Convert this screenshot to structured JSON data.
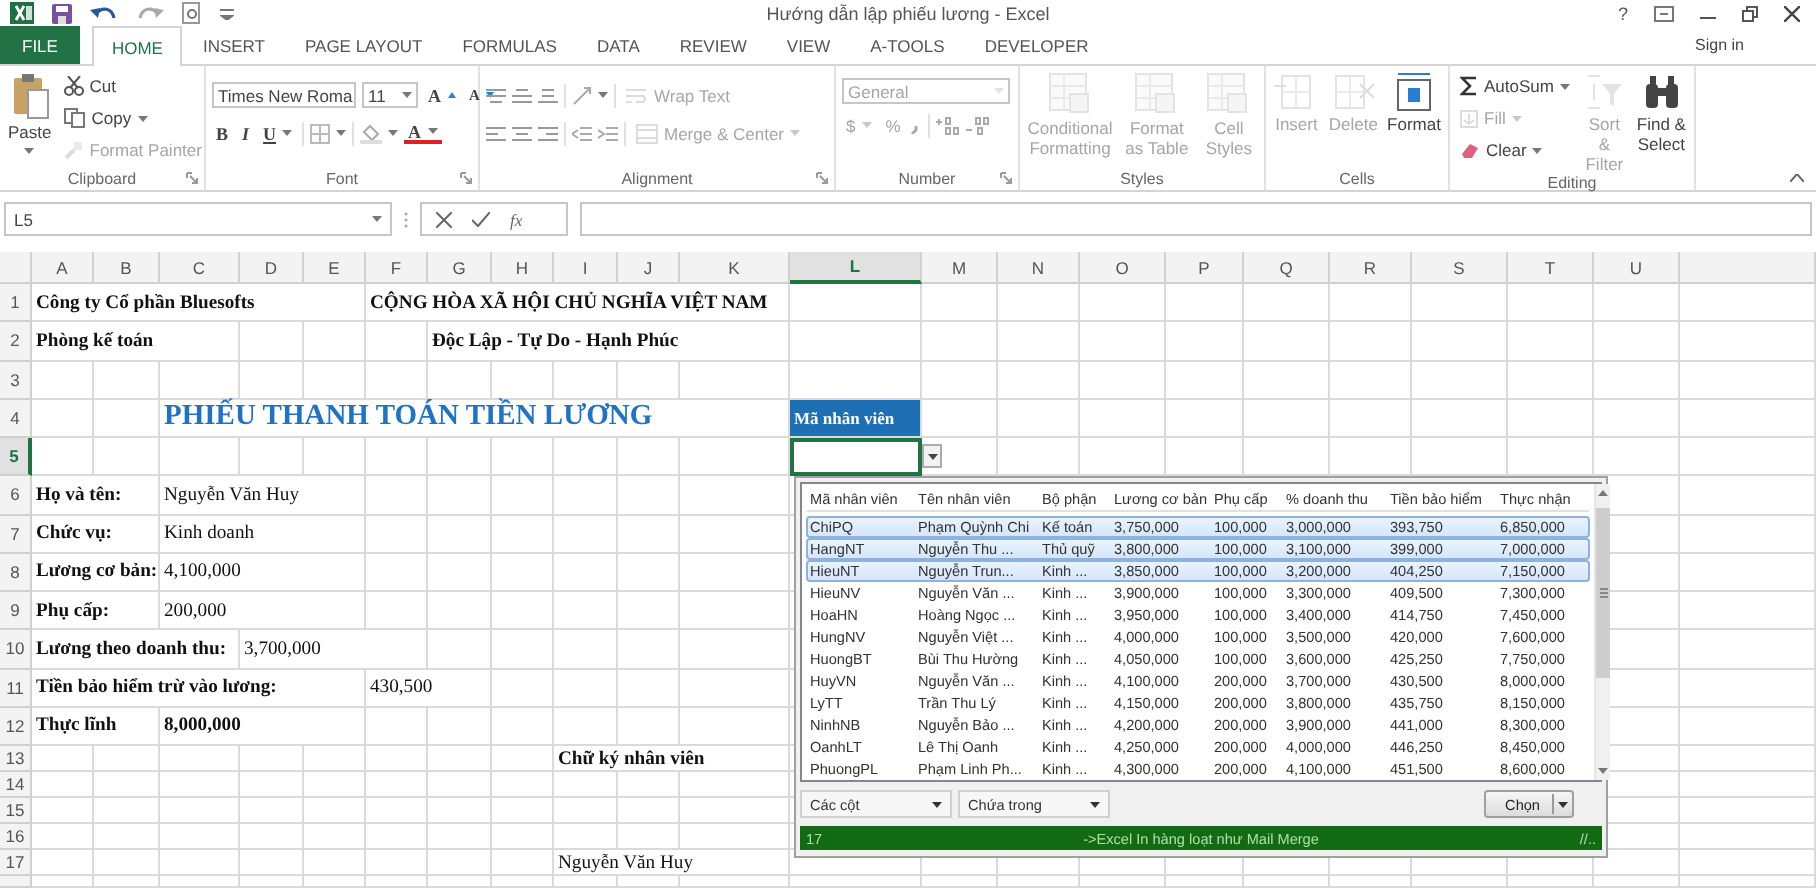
{
  "window": {
    "title": "Hướng dẫn lập phiếu lương - Excel",
    "help": "?",
    "sign_in": "Sign in"
  },
  "tabs": [
    {
      "label": "FILE",
      "kind": "file",
      "selected": false
    },
    {
      "label": "HOME",
      "kind": "tab",
      "selected": true
    },
    {
      "label": "INSERT",
      "kind": "tab",
      "selected": false
    },
    {
      "label": "PAGE LAYOUT",
      "kind": "tab",
      "selected": false
    },
    {
      "label": "FORMULAS",
      "kind": "tab",
      "selected": false
    },
    {
      "label": "DATA",
      "kind": "tab",
      "selected": false
    },
    {
      "label": "REVIEW",
      "kind": "tab",
      "selected": false
    },
    {
      "label": "VIEW",
      "kind": "tab",
      "selected": false
    },
    {
      "label": "A-TOOLS",
      "kind": "tab",
      "selected": false
    },
    {
      "label": "DEVELOPER",
      "kind": "tab",
      "selected": false
    }
  ],
  "ribbon": {
    "groups": [
      {
        "label": "Clipboard",
        "items": [
          {
            "label": "Paste",
            "disabled": false
          },
          {
            "label": "Cut",
            "disabled": false
          },
          {
            "label": "Copy",
            "disabled": false
          },
          {
            "label": "Format Painter",
            "disabled": true
          }
        ]
      },
      {
        "label": "Font",
        "items": [
          {
            "label": "Times New Roma",
            "disabled": false
          },
          {
            "label": "11",
            "disabled": false
          },
          {
            "label": "A",
            "disabled": false
          },
          {
            "label": "A",
            "disabled": false
          },
          {
            "label": "B",
            "disabled": false
          },
          {
            "label": "I",
            "disabled": false
          },
          {
            "label": "U",
            "disabled": false
          },
          {
            "label": "A",
            "disabled": false
          }
        ]
      },
      {
        "label": "Alignment",
        "items": [
          {
            "label": "Wrap Text",
            "disabled": true
          },
          {
            "label": "Merge & Center",
            "disabled": true
          }
        ]
      },
      {
        "label": "Number",
        "items": [
          {
            "label": "General",
            "disabled": true
          },
          {
            "label": "$",
            "disabled": true
          },
          {
            "label": "%",
            "disabled": true
          }
        ]
      },
      {
        "label": "Styles",
        "items": [
          {
            "label": "Conditional Formatting",
            "disabled": true
          },
          {
            "label": "Format as Table",
            "disabled": true
          },
          {
            "label": "Cell Styles",
            "disabled": true
          }
        ]
      },
      {
        "label": "Cells",
        "items": [
          {
            "label": "Insert",
            "disabled": true
          },
          {
            "label": "Delete",
            "disabled": true
          },
          {
            "label": "Format",
            "disabled": false
          }
        ]
      },
      {
        "label": "Editing",
        "items": [
          {
            "label": "AutoSum",
            "disabled": false
          },
          {
            "label": "Fill",
            "disabled": true
          },
          {
            "label": "Clear",
            "disabled": false
          },
          {
            "label": "Sort & Filter",
            "disabled": true
          },
          {
            "label": "Find & Select",
            "disabled": false
          }
        ]
      }
    ]
  },
  "formula_bar": {
    "name_box": "L5",
    "function_label": "fx"
  },
  "sheet": {
    "columns": [
      {
        "label": "A",
        "selected": false
      },
      {
        "label": "B",
        "selected": false
      },
      {
        "label": "C",
        "selected": false
      },
      {
        "label": "D",
        "selected": false
      },
      {
        "label": "E",
        "selected": false
      },
      {
        "label": "F",
        "selected": false
      },
      {
        "label": "G",
        "selected": false
      },
      {
        "label": "H",
        "selected": false
      },
      {
        "label": "I",
        "selected": false
      },
      {
        "label": "J",
        "selected": false
      },
      {
        "label": "K",
        "selected": false
      },
      {
        "label": "L",
        "selected": true
      },
      {
        "label": "M",
        "selected": false
      },
      {
        "label": "N",
        "selected": false
      },
      {
        "label": "O",
        "selected": false
      },
      {
        "label": "P",
        "selected": false
      },
      {
        "label": "Q",
        "selected": false
      },
      {
        "label": "R",
        "selected": false
      },
      {
        "label": "S",
        "selected": false
      },
      {
        "label": "T",
        "selected": false
      },
      {
        "label": "U",
        "selected": false
      }
    ],
    "rows": [
      {
        "label": "1",
        "selected": false,
        "cells": [
          {
            "text": "Công ty Cổ phần Bluesofts",
            "kind": "bold"
          },
          {
            "text": "CỘNG HÒA XÃ HỘI CHỦ NGHĨA VIỆT NAM",
            "kind": "bold"
          }
        ]
      },
      {
        "label": "2",
        "selected": false,
        "cells": [
          {
            "text": "Phòng kế toán",
            "kind": "bold"
          },
          {
            "text": "Độc Lập - Tự Do - Hạnh Phúc",
            "kind": "bold"
          }
        ]
      },
      {
        "label": "3",
        "selected": false
      },
      {
        "label": "4",
        "selected": false,
        "cells": [
          {
            "text": "PHIẾU THANH TOÁN TIỀN LƯƠNG",
            "kind": "title"
          },
          {
            "text": "Mã nhân viên",
            "kind": "header"
          }
        ]
      },
      {
        "label": "5",
        "selected": true
      },
      {
        "label": "6",
        "selected": false,
        "cells": [
          {
            "text": "Họ và tên:",
            "kind": "bold"
          },
          {
            "text": "Nguyễn Văn Huy",
            "kind": "plain"
          }
        ]
      },
      {
        "label": "7",
        "selected": false,
        "cells": [
          {
            "text": "Chức vụ:",
            "kind": "bold"
          },
          {
            "text": "Kinh doanh",
            "kind": "plain"
          }
        ]
      },
      {
        "label": "8",
        "selected": false,
        "cells": [
          {
            "text": "Lương cơ bản:",
            "kind": "bold"
          },
          {
            "text": "4,100,000",
            "kind": "plain"
          }
        ]
      },
      {
        "label": "9",
        "selected": false,
        "cells": [
          {
            "text": "Phụ cấp:",
            "kind": "bold"
          },
          {
            "text": "200,000",
            "kind": "plain"
          }
        ]
      },
      {
        "label": "10",
        "selected": false,
        "cells": [
          {
            "text": "Lương theo doanh thu:",
            "kind": "bold"
          },
          {
            "text": "3,700,000",
            "kind": "plain"
          }
        ]
      },
      {
        "label": "11",
        "selected": false,
        "cells": [
          {
            "text": "Tiền bảo hiểm trừ vào lương:",
            "kind": "bold"
          },
          {
            "text": "430,500",
            "kind": "plain"
          }
        ]
      },
      {
        "label": "12",
        "selected": false,
        "cells": [
          {
            "text": "Thực lĩnh",
            "kind": "bold"
          },
          {
            "text": "8,000,000",
            "kind": "bold"
          }
        ]
      },
      {
        "label": "13",
        "selected": false,
        "cells": [
          {
            "text": "Chữ ký nhân viên",
            "kind": "bold"
          }
        ]
      },
      {
        "label": "14",
        "selected": false
      },
      {
        "label": "15",
        "selected": false
      },
      {
        "label": "16",
        "selected": false
      },
      {
        "label": "17",
        "selected": false,
        "cells": [
          {
            "text": "Nguyễn Văn Huy",
            "kind": "plain"
          }
        ]
      }
    ]
  },
  "lookup": {
    "columns": [
      "Mã nhân viên",
      "Tên nhân viên",
      "Bộ phận",
      "Lương cơ bản",
      "Phụ cấp",
      "% doanh thu",
      "Tiền bảo hiểm",
      "Thực nhận"
    ],
    "rows": [
      {
        "selected": true,
        "cells": [
          "ChiPQ",
          "Phạm Quỳnh Chi",
          "Kế toán",
          "3,750,000",
          "100,000",
          "3,000,000",
          "393,750",
          "6,850,000"
        ]
      },
      {
        "selected": true,
        "cells": [
          "HangNT",
          "Nguyễn Thu ...",
          "Thủ quỹ",
          "3,800,000",
          "100,000",
          "3,100,000",
          "399,000",
          "7,000,000"
        ]
      },
      {
        "selected": true,
        "cells": [
          "HieuNT",
          "Nguyễn Trun...",
          "Kinh ...",
          "3,850,000",
          "100,000",
          "3,200,000",
          "404,250",
          "7,150,000"
        ]
      },
      {
        "selected": false,
        "cells": [
          "HieuNV",
          "Nguyễn Văn ...",
          "Kinh ...",
          "3,900,000",
          "100,000",
          "3,300,000",
          "409,500",
          "7,300,000"
        ]
      },
      {
        "selected": false,
        "cells": [
          "HoaHN",
          "Hoàng Ngọc ...",
          "Kinh ...",
          "3,950,000",
          "100,000",
          "3,400,000",
          "414,750",
          "7,450,000"
        ]
      },
      {
        "selected": false,
        "cells": [
          "HungNV",
          "Nguyễn Việt ...",
          "Kinh ...",
          "4,000,000",
          "100,000",
          "3,500,000",
          "420,000",
          "7,600,000"
        ]
      },
      {
        "selected": false,
        "cells": [
          "HuongBT",
          "Bùi Thu Hường",
          "Kinh ...",
          "4,050,000",
          "100,000",
          "3,600,000",
          "425,250",
          "7,750,000"
        ]
      },
      {
        "selected": false,
        "cells": [
          "HuyVN",
          "Nguyễn Văn ...",
          "Kinh ...",
          "4,100,000",
          "200,000",
          "3,700,000",
          "430,500",
          "8,000,000"
        ]
      },
      {
        "selected": false,
        "cells": [
          "LyTT",
          "Trần Thu Lý",
          "Kinh ...",
          "4,150,000",
          "200,000",
          "3,800,000",
          "435,750",
          "8,150,000"
        ]
      },
      {
        "selected": false,
        "cells": [
          "NinhNB",
          "Nguyễn Bảo ...",
          "Kinh ...",
          "4,200,000",
          "200,000",
          "3,900,000",
          "441,000",
          "8,300,000"
        ]
      },
      {
        "selected": false,
        "cells": [
          "OanhLT",
          "Lê Thị Oanh",
          "Kinh ...",
          "4,250,000",
          "200,000",
          "4,000,000",
          "446,250",
          "8,450,000"
        ]
      },
      {
        "selected": false,
        "cells": [
          "PhuongPL",
          "Phạm Linh Ph...",
          "Kinh ...",
          "4,300,000",
          "200,000",
          "4,100,000",
          "451,500",
          "8,600,000"
        ]
      }
    ],
    "filter_column": "Các cột",
    "filter_mode": "Chứa trong",
    "choose": "Chọn",
    "status": {
      "count": "17",
      "message": "->Excel In hàng loạt như Mail Merge",
      "grip": "//.."
    }
  }
}
